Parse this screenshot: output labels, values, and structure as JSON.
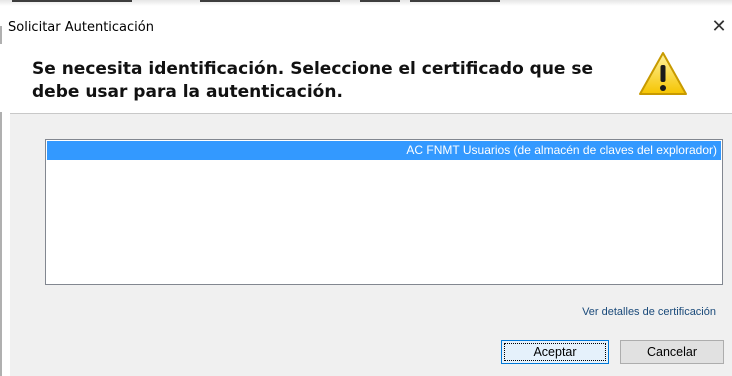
{
  "window": {
    "title": "Solicitar Autenticación",
    "close_glyph": "✕"
  },
  "header": {
    "heading": "Se necesita identificación. Seleccione el certificado que se debe usar para la autenticación.",
    "icon": "warning-icon"
  },
  "certificates": {
    "items": [
      {
        "label": "AC FNMT Usuarios (de almacén de claves del explorador)",
        "selected": true
      }
    ]
  },
  "links": {
    "details": "Ver detalles de certificación"
  },
  "buttons": {
    "accept": "Aceptar",
    "cancel": "Cancelar"
  },
  "colors": {
    "selection": "#3399ff",
    "warning_yellow": "#ffcc00",
    "body_background": "#f0f0f0"
  }
}
